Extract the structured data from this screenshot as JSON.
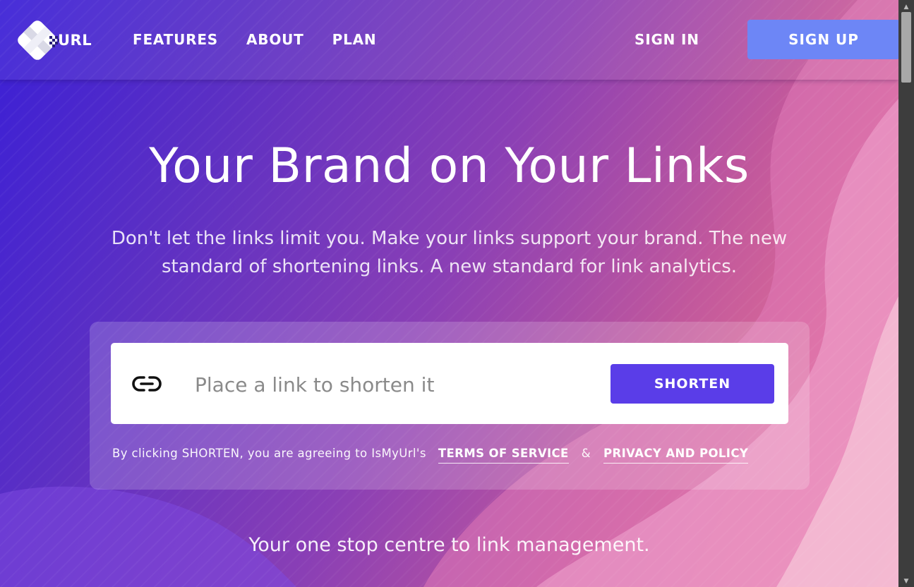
{
  "brand": {
    "logo_text": "URL"
  },
  "nav": {
    "items": [
      {
        "label": "FEATURES"
      },
      {
        "label": "ABOUT"
      },
      {
        "label": "PLAN"
      }
    ],
    "sign_in": "SIGN IN",
    "sign_up": "SIGN UP"
  },
  "hero": {
    "title": "Your Brand on Your Links",
    "subtitle": "Don't let the links limit you. Make your links support your brand. The new standard of shortening links. A new standard for link analytics."
  },
  "shortener": {
    "icon": "link-icon",
    "input_placeholder": "Place a link to shorten it",
    "input_value": "",
    "button_label": "SHORTEN",
    "terms_prefix": "By clicking SHORTEN, you are agreeing to IsMyUrl's",
    "terms_link": "TERMS OF SERVICE",
    "ampersand": "&",
    "privacy_link": "PRIVACY AND POLICY"
  },
  "tagline": "Your one stop centre to link management.",
  "colors": {
    "signup_button": "#6d86f6",
    "shorten_button": "#5a3de8",
    "gradient_start": "#3a1fd6",
    "gradient_end": "#f49aa0"
  }
}
